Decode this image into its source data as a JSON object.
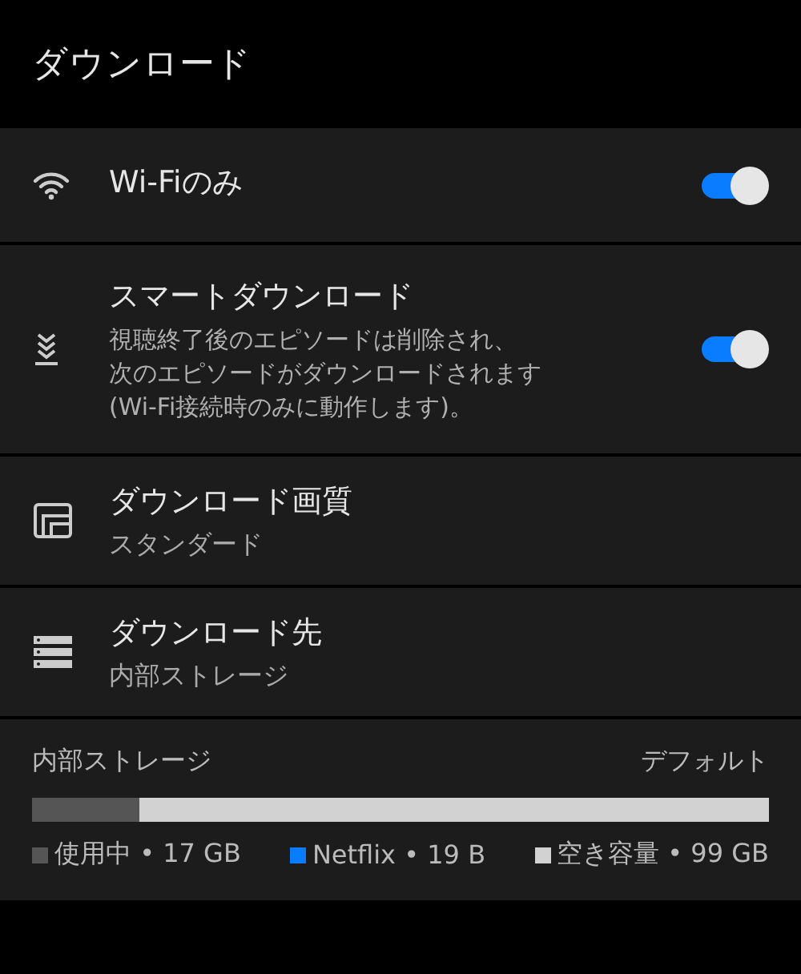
{
  "header": {
    "title": "ダウンロード"
  },
  "settings": [
    {
      "kind": "toggle",
      "label": "Wi-Fiのみ",
      "on": true
    },
    {
      "kind": "toggle",
      "label": "スマートダウンロード",
      "description": [
        "視聴終了後のエピソードは削除され、",
        "次のエピソードがダウンロードされます",
        "(Wi-Fi接続時のみに動作します)。"
      ],
      "on": true
    },
    {
      "kind": "choice",
      "label": "ダウンロード画質",
      "value": "スタンダード"
    },
    {
      "kind": "choice",
      "label": "ダウンロード先",
      "value": "内部ストレージ"
    }
  ],
  "storage": {
    "name": "内部ストレージ",
    "tag": "デフォルト",
    "level": 0.146,
    "legend": [
      {
        "label": "使用中 • 17 GB",
        "color": "#555555"
      },
      {
        "label": "Netflix • 19 B",
        "color": "#0a7cff"
      },
      {
        "label": "空き容量 • 99 GB",
        "color": "#d2d2d2"
      }
    ]
  }
}
